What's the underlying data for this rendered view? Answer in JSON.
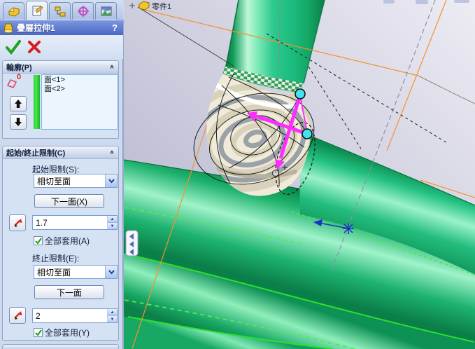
{
  "window": {
    "tabs": [
      {
        "icon": "part-tab-icon",
        "active": false
      },
      {
        "icon": "property-manager-tab-icon",
        "active": true
      },
      {
        "icon": "configuration-tab-icon",
        "active": false
      },
      {
        "icon": "dimxpert-tab-icon",
        "active": false
      },
      {
        "icon": "display-manager-tab-icon",
        "active": false
      }
    ]
  },
  "property_manager": {
    "title": "疊層拉伸1",
    "help": "?",
    "profiles": {
      "header": "輪廓(P)",
      "count_badge": "0",
      "items": [
        "面<1>",
        "面<2>"
      ]
    },
    "constraints": {
      "header": "起始/終止限制(C)",
      "start_label": "起始限制(S):",
      "start_value": "相切至面",
      "next_face_1": "下一面(X)",
      "start_tangent_length": "1.7",
      "apply_all_start": "全部套用(A)",
      "end_label": "終止限制(E):",
      "end_value": "相切至面",
      "next_face_2": "下一面",
      "end_tangent_length": "2",
      "apply_all_end": "全部套用(Y)"
    }
  },
  "viewport": {
    "part_label": "零件1"
  },
  "colors": {
    "tube_green": "#19b877",
    "bright_edge": "#2be02b",
    "magenta_handle": "#ff2bff",
    "selection_cyan": "#3fe4f0",
    "box_orange": "#f5922d"
  }
}
